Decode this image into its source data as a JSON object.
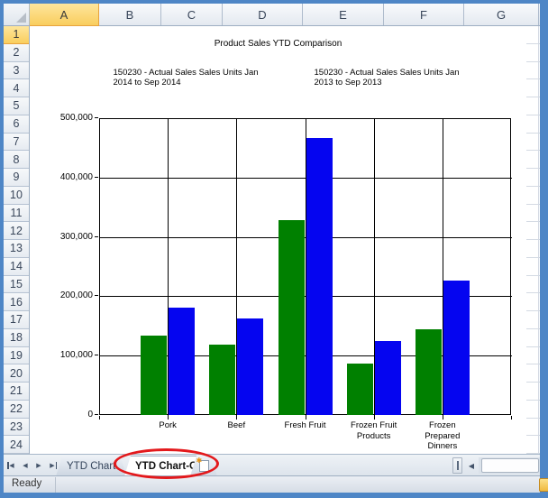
{
  "chart_data": {
    "type": "bar",
    "title": "Product Sales YTD Comparison",
    "categories": [
      "Pork",
      "Beef",
      "Fresh Fruit",
      "Frozen Fruit Products",
      "Frozen Prepared Dinners"
    ],
    "series": [
      {
        "name": "150230 - Actual Sales Sales Units Jan 2014 to Sep 2014",
        "color": "#008000",
        "values": [
          134000,
          118000,
          328000,
          87000,
          144000
        ]
      },
      {
        "name": "150230 - Actual Sales Sales Units Jan 2013 to Sep 2013",
        "color": "#0505f0",
        "values": [
          181000,
          163000,
          466000,
          124000,
          226000
        ]
      }
    ],
    "xlabel": "",
    "ylabel": "",
    "ylim": [
      0,
      500000
    ],
    "ytick_interval": 100000,
    "ytick_labels": [
      "0",
      "100,000",
      "200,000",
      "300,000",
      "400,000",
      "500,000"
    ],
    "grid": "both",
    "legend_position": "top"
  },
  "spreadsheet": {
    "column_headers": [
      "A",
      "B",
      "C",
      "D",
      "E",
      "F",
      "G"
    ],
    "selected_column": "A",
    "row_headers": [
      "1",
      "2",
      "3",
      "4",
      "5",
      "6",
      "7",
      "8",
      "9",
      "10",
      "11",
      "12",
      "13",
      "14",
      "15",
      "16",
      "17",
      "18",
      "19",
      "20",
      "21",
      "22",
      "23",
      "24"
    ],
    "selected_row": "1"
  },
  "sheet_tabs": {
    "navigation": {
      "first": "◀",
      "prev": "◀",
      "next": "▶",
      "last": "▶"
    },
    "tabs": [
      {
        "label": "YTD Chart",
        "active": false
      },
      {
        "label": "YTD Chart-C",
        "active": true
      }
    ],
    "insert_worksheet_icon": "✱",
    "scroll_left_icon": "◀"
  },
  "status_bar": {
    "mode": "Ready"
  },
  "annotation": {
    "shape": "ellipse",
    "color": "#e3191c",
    "target_tab": "YTD Chart-C"
  },
  "colors": {
    "window_border": "#4e86c6",
    "selected_header_fill": "#f9ce5e",
    "series_2014": "#008000",
    "series_2013": "#0505f0"
  }
}
